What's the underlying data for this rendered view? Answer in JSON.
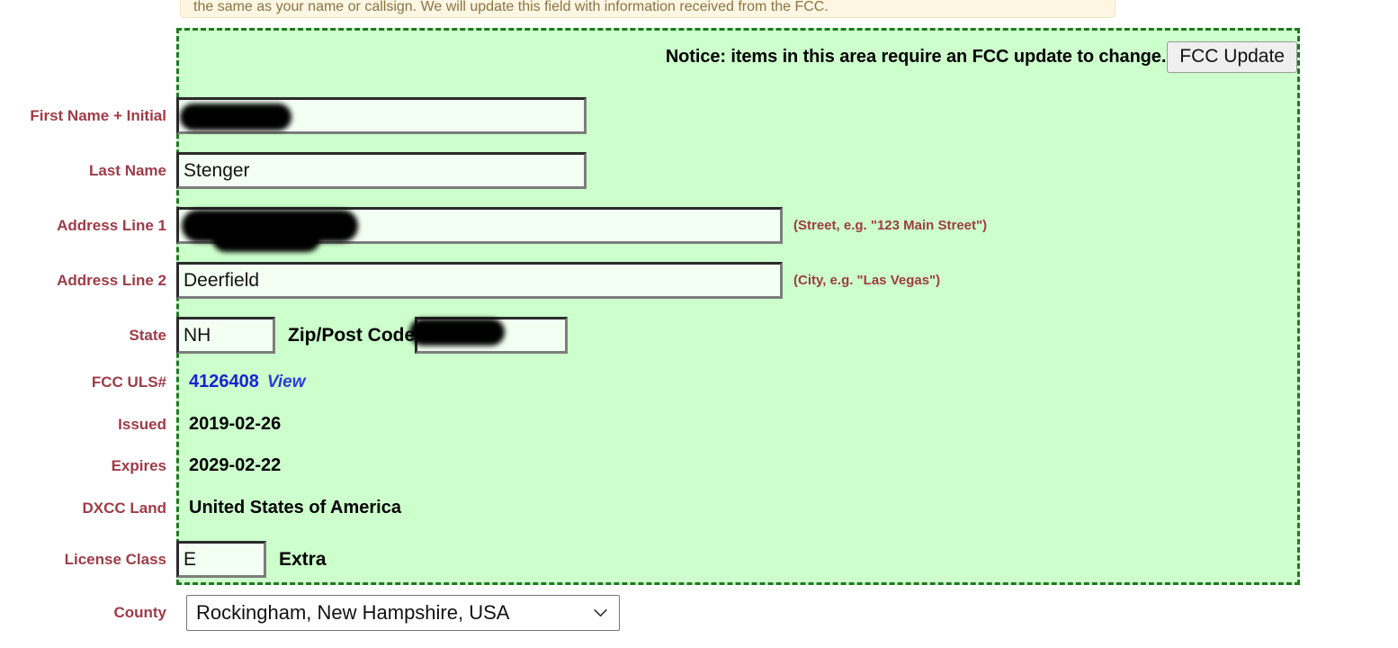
{
  "banner": {
    "text": "the same as your name or callsign. We will update this field with information received from the FCC."
  },
  "fcc_region": {
    "notice": "Notice: items in this area require an FCC update to change.",
    "update_button": "FCC Update"
  },
  "fields": {
    "first_name_label": "First Name + Initial",
    "first_name_value": "",
    "last_name_label": "Last Name",
    "last_name_value": "Stenger",
    "address1_label": "Address Line 1",
    "address1_value": "",
    "address1_hint": "(Street, e.g. \"123 Main Street\")",
    "address2_label": "Address Line 2",
    "address2_value": "Deerfield",
    "address2_hint": "(City, e.g. \"Las Vegas\")",
    "state_label": "State",
    "state_value": "NH",
    "zip_label": "Zip/Post Code",
    "zip_value": "",
    "uls_label": "FCC ULS#",
    "uls_value": "4126408",
    "uls_view_link": "View",
    "issued_label": "Issued",
    "issued_value": "2019-02-26",
    "expires_label": "Expires",
    "expires_value": "2029-02-22",
    "dxcc_label": "DXCC Land",
    "dxcc_value": "United States of America",
    "license_class_label": "License Class",
    "license_class_value": "E",
    "license_class_name": "Extra",
    "county_label": "County",
    "county_value": "Rockingham, New Hampshire, USA"
  },
  "colors": {
    "label_red": "#9e3b47",
    "region_green": "#ccffcc",
    "region_border": "#1f7a1f",
    "link_blue": "#1a22d0",
    "banner_bg": "#fdf6e3",
    "input_bg": "#f2fff2"
  }
}
